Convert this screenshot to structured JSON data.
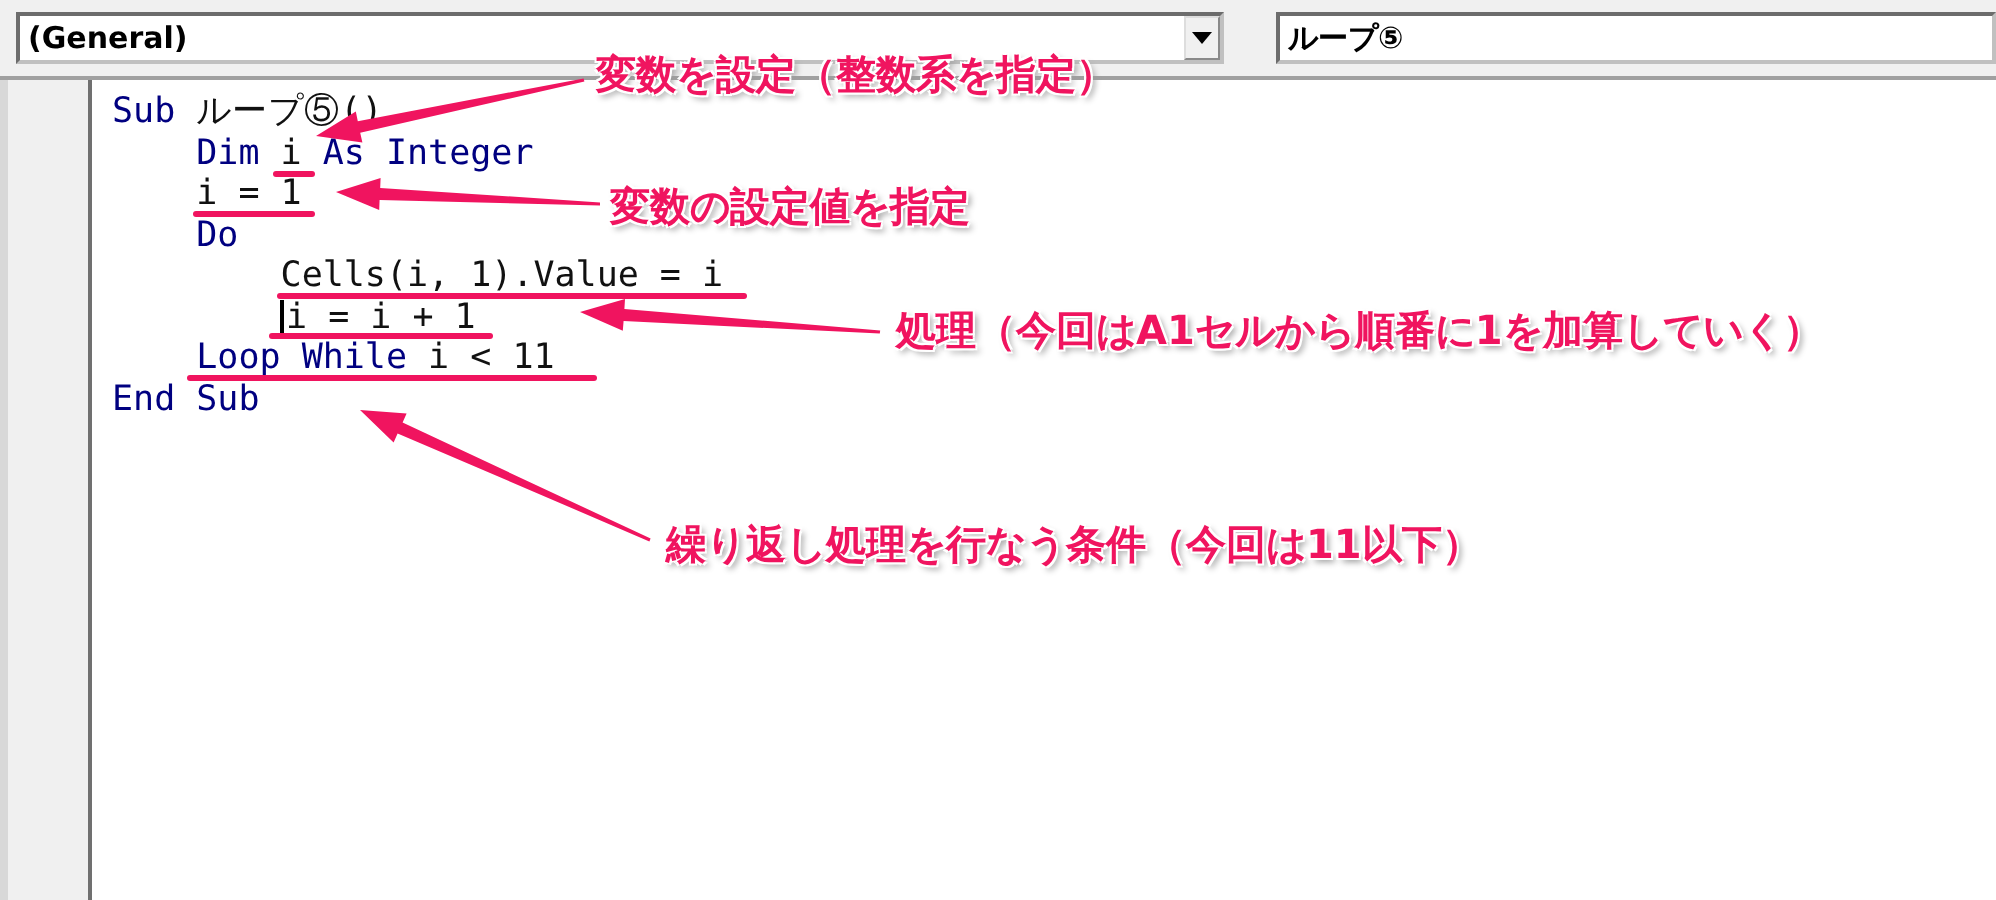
{
  "object_box": {
    "value": "(General)"
  },
  "procedure_box": {
    "value": "ループ⑤"
  },
  "code_lines": [
    {
      "cursor": false,
      "tokens": [
        {
          "text": "Sub ",
          "kind": "keyword"
        },
        {
          "text": "ループ⑤()",
          "kind": "plain"
        }
      ]
    },
    {
      "cursor": false,
      "tokens": [
        {
          "text": "    Dim ",
          "kind": "keyword"
        },
        {
          "text": "i ",
          "kind": "plain"
        },
        {
          "text": "As Integer",
          "kind": "keyword"
        }
      ]
    },
    {
      "cursor": false,
      "tokens": [
        {
          "text": "    i = 1",
          "kind": "plain"
        }
      ]
    },
    {
      "cursor": false,
      "tokens": [
        {
          "text": "    Do",
          "kind": "keyword"
        }
      ]
    },
    {
      "cursor": false,
      "tokens": [
        {
          "text": "        Cells(i, 1).Value = i",
          "kind": "plain"
        }
      ]
    },
    {
      "cursor": true,
      "tokens": [
        {
          "text": "i = i + 1",
          "kind": "plain"
        }
      ]
    },
    {
      "cursor": false,
      "tokens": [
        {
          "text": "    Loop While ",
          "kind": "keyword"
        },
        {
          "text": "i < 11",
          "kind": "plain"
        }
      ]
    },
    {
      "cursor": false,
      "tokens": [
        {
          "text": "End Sub",
          "kind": "keyword"
        }
      ]
    }
  ],
  "annotations": [
    {
      "text": "変数を設定（整数系を指定）"
    },
    {
      "text": "変数の設定値を指定"
    },
    {
      "text": "処理（今回はA1セルから順番に1を加算していく）"
    },
    {
      "text": "繰り返し処理を行なう条件（今回は11以下）"
    }
  ]
}
